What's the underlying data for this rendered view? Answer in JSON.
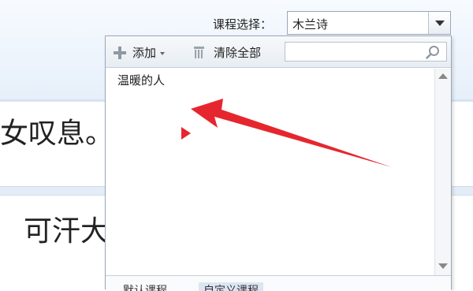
{
  "background": {
    "text_line_1": "女叹息。",
    "text_line_2": "可汗大"
  },
  "course_selector": {
    "label": "课程选择：",
    "value": "木兰诗"
  },
  "dropdown": {
    "toolbar": {
      "add_label": "添加",
      "clear_all_label": "清除全部",
      "search_value": ""
    },
    "items": [
      {
        "label": "温暖的人"
      }
    ],
    "tabs": {
      "default_label": "默认课程",
      "custom_label": "自定义课程"
    }
  },
  "colors": {
    "accent_red": "#e6262e",
    "border": "#9aa8b8",
    "toolbar_bg": "#e7edf3"
  },
  "icons": [
    "plus-icon",
    "caret-icon",
    "trash-icon",
    "search-icon",
    "chevron-down-icon",
    "marker-icon",
    "annotation-arrow"
  ]
}
